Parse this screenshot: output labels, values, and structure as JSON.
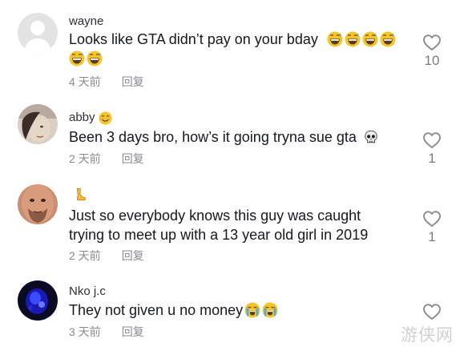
{
  "colors": {
    "text": "#161823",
    "meta": "#8a8b91",
    "like_icon": "#8a8b91"
  },
  "comments": [
    {
      "username": "wayne",
      "avatar": "default-avatar",
      "text": "Looks like GTA didn’t pay on your bday",
      "emojis": [
        "grinning-sweat-emoji",
        "grinning-sweat-emoji",
        "grinning-sweat-emoji",
        "grinning-sweat-emoji",
        "grinning-sweat-emoji",
        "grinning-sweat-emoji"
      ],
      "time": "4 天前",
      "reply": "回复",
      "likes": "10"
    },
    {
      "username": "abby",
      "username_emoji": "smiling-face-emoji",
      "avatar": "photo-avatar",
      "text": "Been 3 days bro, how’s it going tryna sue gta",
      "emojis": [
        "skull-emoji"
      ],
      "time": "2 天前",
      "reply": "回复",
      "likes": "1"
    },
    {
      "username": "",
      "username_emoji": "leg-emoji",
      "avatar": "photo-avatar",
      "text": "Just so everybody knows this guy was caught trying to meet up with a 13 year old girl in 2019",
      "time": "2 天前",
      "reply": "回复",
      "likes": "1"
    },
    {
      "username": "Nko j.c",
      "avatar": "photo-avatar",
      "text": "They not given u no money",
      "emojis": [
        "crying-face-emoji",
        "crying-face-emoji"
      ],
      "time": "3 天前",
      "reply": "回复",
      "likes": ""
    }
  ],
  "watermark": "游侠网"
}
